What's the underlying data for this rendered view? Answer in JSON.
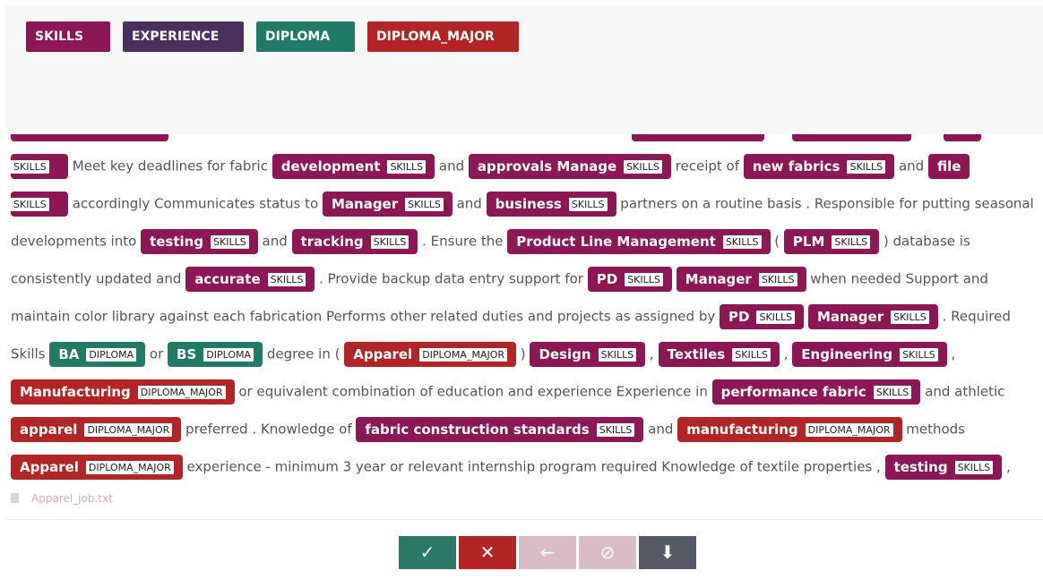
{
  "labels": [
    {
      "name": "SKILLS",
      "color": "#8e1556"
    },
    {
      "name": "EXPERIENCE",
      "color": "#4a2f5f"
    },
    {
      "name": "DIPLOMA",
      "color": "#1f7a66"
    },
    {
      "name": "DIPLOMA_MAJOR",
      "color": "#b52424"
    }
  ],
  "tags": {
    "skills": "SKILLS",
    "diploma": "DIPLOMA",
    "major": "DIPLOMA_MAJOR"
  },
  "doc": {
    "l1": {
      "t0": "Meet key deadlines for fabric",
      "e1": "development",
      "t2": "and",
      "e3": "approvals Manage",
      "t4": "receipt of",
      "e5": "new fabrics",
      "t6": "and",
      "e7": "file"
    },
    "l2": {
      "t0": "accordingly Communicates status to",
      "e1": "Manager",
      "t2": "and",
      "e3": "business",
      "t4": "partners on a routine basis . Responsible for putting seasonal"
    },
    "l3": {
      "t0": "developments into",
      "e1": "testing",
      "t2": "and",
      "e3": "tracking",
      "t4": ". Ensure the",
      "e5": "Product Line Management",
      "t6": "(",
      "e7": "PLM",
      "t8": ") database is"
    },
    "l4": {
      "t0": "consistently updated and",
      "e1": "accurate",
      "t2": ". Provide backup data entry support for",
      "e3": "PD",
      "e4": "Manager",
      "t5": "when needed Support and"
    },
    "l5": {
      "t0": "maintain color library against each fabrication Performs other related duties and projects as assigned by",
      "e1": "PD",
      "e2": "Manager",
      "t3": ". Required"
    },
    "l6": {
      "t0": "Skills",
      "e1": "BA",
      "t2": "or",
      "e3": "BS",
      "t4": "degree in (",
      "e5": "Apparel",
      "t6": ")",
      "e7": "Design",
      "t8": ",",
      "e9": "Textiles",
      "t10": ",",
      "e11": "Engineering",
      "t12": ","
    },
    "l7": {
      "e0": "Manufacturing",
      "t1": "or equivalent combination of education and experience Experience in",
      "e2": "performance fabric",
      "t3": "and athletic"
    },
    "l8": {
      "e0": "apparel",
      "t1": "preferred . Knowledge of",
      "e2": "fabric construction standards",
      "t3": "and",
      "e4": "manufacturing",
      "t5": "methods"
    },
    "l9": {
      "e0": "Apparel",
      "t1": "experience - minimum 3 year or relevant internship program required Knowledge of textile properties ,",
      "e2": "testing",
      "t3": ","
    }
  },
  "file_name": "Apparel_job.txt",
  "toolbar": [
    {
      "icon": "check-icon",
      "glyph": "✓",
      "color": "#2b7a68"
    },
    {
      "icon": "close-icon",
      "glyph": "✕",
      "color": "#b52424"
    },
    {
      "icon": "arrow-left-icon",
      "glyph": "←",
      "color": "#d9bcc6"
    },
    {
      "icon": "block-icon",
      "glyph": "⊘",
      "color": "#d9bcc6"
    },
    {
      "icon": "save-icon",
      "glyph": "⬇",
      "color": "#555a66"
    }
  ]
}
